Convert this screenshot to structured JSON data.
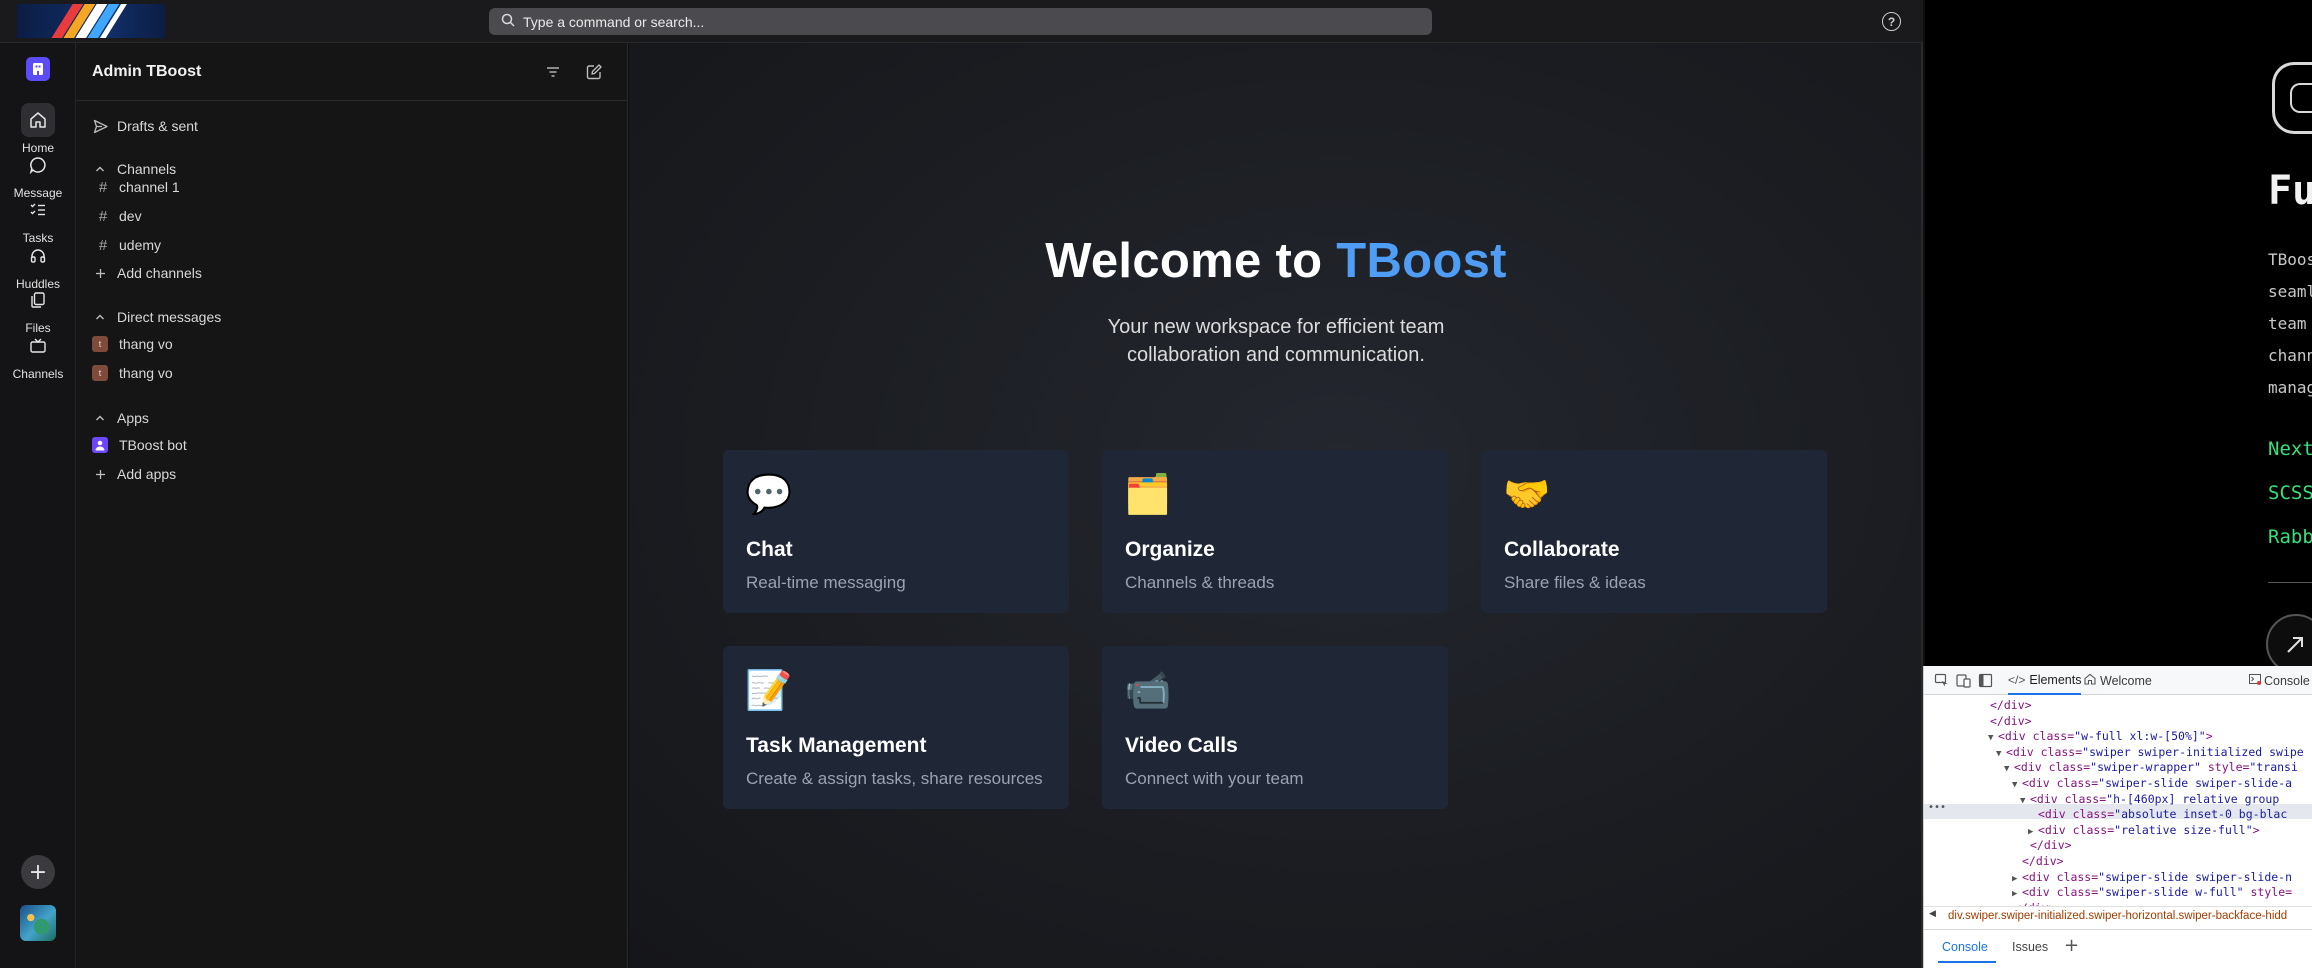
{
  "search": {
    "placeholder": "Type a command or search..."
  },
  "help": {
    "label": "?"
  },
  "rail": {
    "items": [
      {
        "label": "Home",
        "icon": "home-icon"
      },
      {
        "label": "Message",
        "icon": "message-icon"
      },
      {
        "label": "Tasks",
        "icon": "tasks-icon"
      },
      {
        "label": "Huddles",
        "icon": "headphones-icon"
      },
      {
        "label": "Files",
        "icon": "files-icon"
      },
      {
        "label": "Channels",
        "icon": "tv-icon"
      }
    ],
    "add": "+"
  },
  "sidebar": {
    "title": "Admin TBoost",
    "drafts": "Drafts & sent",
    "channels_header": "Channels",
    "channels": [
      "channel 1",
      "dev",
      "udemy"
    ],
    "add_channels": "Add channels",
    "dm_header": "Direct messages",
    "dms": [
      {
        "name": "thang vo",
        "initial": "t"
      },
      {
        "name": "thang vo",
        "initial": "t"
      }
    ],
    "apps_header": "Apps",
    "apps": [
      "TBoost bot"
    ],
    "add_apps": "Add apps"
  },
  "main": {
    "title_prefix": "Welcome to",
    "title_accent": "TBoost",
    "subtitle_line1": "Your new workspace for efficient team",
    "subtitle_line2": "collaboration and communication.",
    "cards": [
      {
        "emoji": "💬",
        "title": "Chat",
        "desc": "Real-time messaging"
      },
      {
        "emoji": "🗂️",
        "title": "Organize",
        "desc": "Channels & threads"
      },
      {
        "emoji": "🤝",
        "title": "Collaborate",
        "desc": "Share files & ideas"
      },
      {
        "emoji": "📝",
        "title": "Task Management",
        "desc": "Create & assign tasks, share resources"
      },
      {
        "emoji": "📹",
        "title": "Video Calls",
        "desc": "Connect with your team"
      }
    ]
  },
  "preview": {
    "heading": "Fu",
    "lines": [
      "TBoos",
      "seaml",
      "team ",
      "chann",
      "manag"
    ],
    "tech": [
      "Next",
      "SCSS",
      "Rabb"
    ]
  },
  "devtools": {
    "tabs": [
      "Elements",
      "Welcome",
      "Console"
    ],
    "bottom_tabs": [
      "Console",
      "Issues"
    ],
    "breadcrumb": "div.swiper.swiper-initialized.swiper-horizontal.swiper-backface-hidd",
    "code": [
      {
        "indent": 0,
        "tri": "",
        "text": "</div>"
      },
      {
        "indent": 0,
        "tri": "",
        "text": "</div>"
      },
      {
        "indent": 1,
        "tri": "▼",
        "text": "<div class=\"w-full xl:w-[50%]\">"
      },
      {
        "indent": 2,
        "tri": "▼",
        "text": "<div class=\"swiper swiper-initialized swipe"
      },
      {
        "indent": 3,
        "tri": "▼",
        "text": "<div class=\"swiper-wrapper\" style=\"transi"
      },
      {
        "indent": 4,
        "tri": "▼",
        "text": "<div class=\"swiper-slide swiper-slide-a"
      },
      {
        "indent": 5,
        "tri": "▼",
        "text": "<div class=\"h-[460px] relative group"
      },
      {
        "indent": 6,
        "tri": "",
        "text": "<div class=\"absolute inset-0 bg-blac"
      },
      {
        "indent": 6,
        "tri": "▶",
        "text": "<div class=\"relative size-full\">"
      },
      {
        "indent": 5,
        "tri": "",
        "text": "</div>"
      },
      {
        "indent": 4,
        "tri": "",
        "text": "</div>"
      },
      {
        "indent": 4,
        "tri": "▶",
        "text": "<div class=\"swiper-slide swiper-slide-n"
      },
      {
        "indent": 4,
        "tri": "▶",
        "text": "<div class=\"swiper-slide w-full\" style="
      },
      {
        "indent": 3,
        "tri": "",
        "text": "</div>"
      }
    ]
  }
}
